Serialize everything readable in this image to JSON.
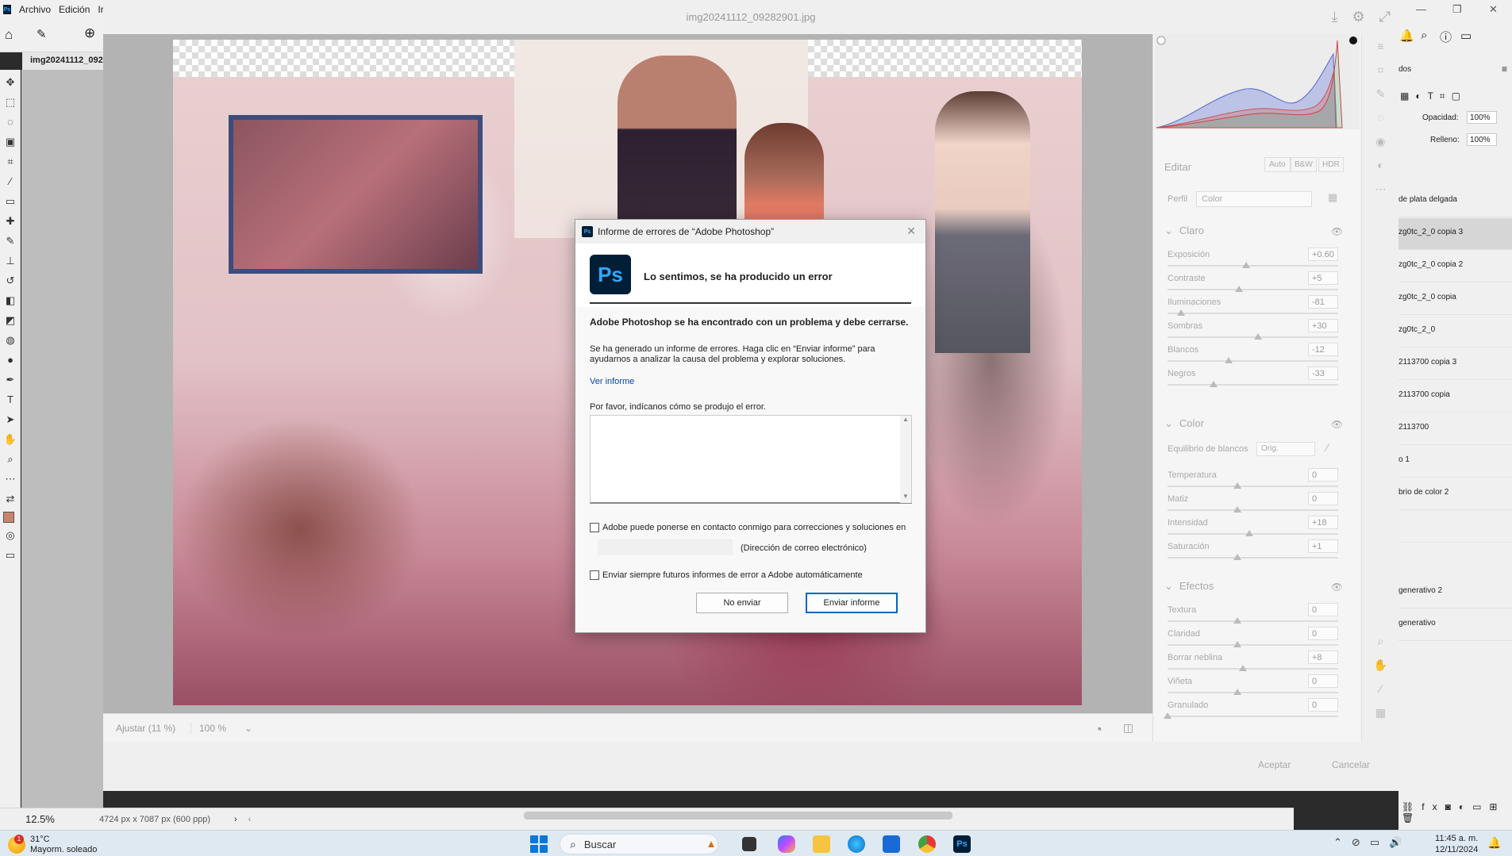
{
  "ps": {
    "menu": [
      "Archivo",
      "Edición",
      "Ir"
    ],
    "doc_tab": "img20241112_092",
    "zoom": "12.5%",
    "doc_info": "4724 px x 7087 px (600 ppp)",
    "layers_header": "dos",
    "opacity_label": "Opacidad:",
    "opacity_value": "100%",
    "fill_label": "Relleno:",
    "fill_value": "100%",
    "layers": [
      "de plata delgada",
      "zg0tc_2_0 copia 3",
      "zg0tc_2_0 copia 2",
      "zg0tc_2_0 copia",
      "zg0tc_2_0",
      "2113700 copia 3",
      "2113700 copia",
      "2113700",
      "o 1",
      "brio de color 2",
      "",
      "generativo 2",
      "generativo"
    ]
  },
  "camera_raw": {
    "title": "img20241112_09282901.jpg",
    "fit_label": "Ajustar (11 %)",
    "zoom_label": "100 %",
    "accept": "Aceptar",
    "cancel": "Cancelar",
    "edit_label": "Editar",
    "auto": "Auto",
    "bw": "B&W",
    "hdr": "HDR",
    "profile_label": "Perfil",
    "profile_value": "Color",
    "sections": {
      "light": "Claro",
      "color": "Color",
      "effects": "Efectos"
    },
    "light": [
      {
        "label": "Exposición",
        "value": "+0.60",
        "pos": 0.46
      },
      {
        "label": "Contraste",
        "value": "+5",
        "pos": 0.42
      },
      {
        "label": "Iluminaciones",
        "value": "-81",
        "pos": 0.08
      },
      {
        "label": "Sombras",
        "value": "+30",
        "pos": 0.53
      },
      {
        "label": "Blancos",
        "value": "-12",
        "pos": 0.36
      },
      {
        "label": "Negros",
        "value": "-33",
        "pos": 0.27
      }
    ],
    "wb_label": "Equilibrio de blancos",
    "wb_value": "Orig.",
    "color": [
      {
        "label": "Temperatura",
        "value": "0",
        "pos": 0.41
      },
      {
        "label": "Matiz",
        "value": "0",
        "pos": 0.41
      },
      {
        "label": "Intensidad",
        "value": "+18",
        "pos": 0.48
      },
      {
        "label": "Saturación",
        "value": "+1",
        "pos": 0.41
      }
    ],
    "effects": [
      {
        "label": "Textura",
        "value": "0",
        "pos": 0.41
      },
      {
        "label": "Claridad",
        "value": "0",
        "pos": 0.41
      },
      {
        "label": "Borrar neblina",
        "value": "+8",
        "pos": 0.44
      },
      {
        "label": "Viñeta",
        "value": "0",
        "pos": 0.41
      },
      {
        "label": "Granulado",
        "value": "0",
        "pos": 0.0
      }
    ]
  },
  "dialog": {
    "title": "Informe de errores de “Adobe Photoshop”",
    "logo": "Ps",
    "sorry": "Lo sentimos, se ha producido un error",
    "headline": "Adobe Photoshop se ha encontrado con un problema y debe cerrarse.",
    "message": "Se ha generado un informe de errores. Haga clic en “Enviar informe” para ayudarnos a analizar la causa del problema y explorar soluciones.",
    "view_report": "Ver informe",
    "prompt": "Por favor, indícanos cómo se produjo el error.",
    "contact_check": "Adobe puede ponerse en contacto conmigo para correcciones y soluciones en",
    "email_label": "(Dirección de correo electrónico)",
    "always_check": "Enviar siempre futuros informes de error a Adobe automáticamente",
    "no_send": "No enviar",
    "send": "Enviar informe"
  },
  "taskbar": {
    "temp": "31°C",
    "weather": "Mayorm. soleado",
    "weather_badge": "1",
    "search": "Buscar",
    "time": "11:45 a. m.",
    "date": "12/11/2024"
  }
}
